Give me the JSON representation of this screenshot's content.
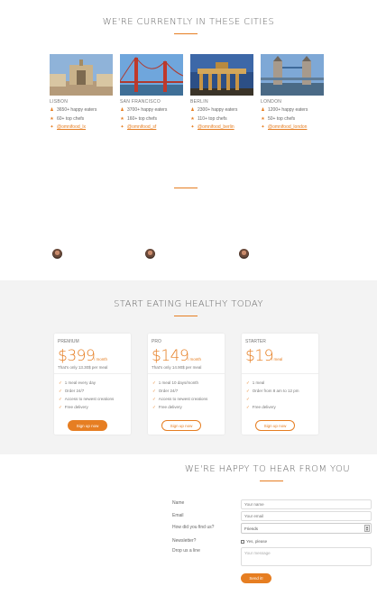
{
  "cities_section": {
    "title": "We're currently in these cities",
    "cities": [
      {
        "name": "Lisbon",
        "customers": "3650+ happy eaters",
        "chefs": "60+ top chefs",
        "twitter": "@omnifood_lx"
      },
      {
        "name": "San Francisco",
        "customers": "3700+ happy eaters",
        "chefs": "160+ top chefs",
        "twitter": "@omnifood_sf"
      },
      {
        "name": "Berlin",
        "customers": "2300+ happy eaters",
        "chefs": "110+ top chefs",
        "twitter": "@omnifood_berlin"
      },
      {
        "name": "London",
        "customers": "1200+ happy eaters",
        "chefs": "50+ top chefs",
        "twitter": "@omnifood_london"
      }
    ]
  },
  "plans_section": {
    "title": "Start eating healthy today",
    "plans": [
      {
        "name": "Premium",
        "price": "$399",
        "per": "/ month",
        "note": "That's only 13.30$ per meal",
        "features": [
          "1 meal every day",
          "Order 24/7",
          "Access to newest creations",
          "Free delivery"
        ],
        "button": "Sign up now",
        "style": "fill"
      },
      {
        "name": "Pro",
        "price": "$149",
        "per": "/ month",
        "note": "That's only 14.90$ per meal",
        "features": [
          "1 meal 10 days/month",
          "Order 24/7",
          "Access to newest creations",
          "Free delivery"
        ],
        "button": "Sign up now",
        "style": "ghost"
      },
      {
        "name": "Starter",
        "price": "$19",
        "per": "/ meal",
        "note": "",
        "features": [
          "1 meal",
          "Order from 8 am to 12 pm",
          "",
          "Free delivery"
        ],
        "button": "Sign up now",
        "style": "ghost"
      }
    ]
  },
  "contact_section": {
    "title": "We're happy to hear from you",
    "labels": {
      "name": "Name",
      "email": "Email",
      "find_us": "How did you find us?",
      "newsletter": "Newsletter?",
      "message": "Drop us a line"
    },
    "placeholders": {
      "name": "Your name",
      "email": "Your email",
      "message": "Your message"
    },
    "find_us_value": "Friends",
    "newsletter_option": "Yes, please",
    "submit": "Send it!"
  },
  "colors": {
    "accent": "#e67e22",
    "section_bg": "#f3f3f3"
  }
}
